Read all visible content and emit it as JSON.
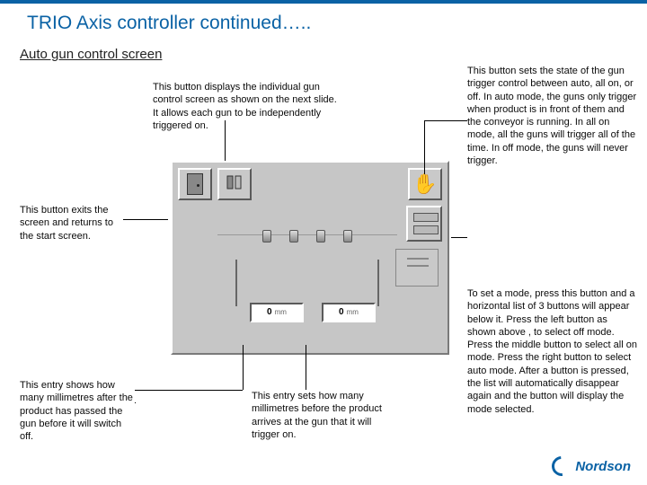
{
  "title": "TRIO Axis controller continued…..",
  "subtitle": "Auto gun control screen",
  "annotations": {
    "individual": "This button displays the individual gun control screen as shown on the next slide. It allows each gun to be independently triggered on.",
    "trigger_mode": "This button sets the state of the gun trigger control between auto, all on, or off. In auto mode, the guns only trigger when product is in front of them and the conveyor is running. In all on mode, all the guns will trigger all of the time. In off mode, the guns will never trigger.",
    "exit": "This button exits the screen and returns to the start screen.",
    "mode_set": "To set a mode, press this button and a horizontal list of 3 buttons will appear below it. Press the left button as shown above , to select off mode. Press the middle button to select all on mode. Press the right button to select auto mode. After a button is pressed, the list will automatically disappear again and the button will display the mode selected.",
    "entry_off": "This entry shows how many millimetres after the product has passed the gun before it will switch off.",
    "entry_on": "This entry sets how many millimetres before the product arrives at the gun that it will trigger on."
  },
  "hmi": {
    "entry_off_value": "0",
    "entry_on_value": "0",
    "entry_unit": "mm"
  },
  "brand": "Nordson"
}
